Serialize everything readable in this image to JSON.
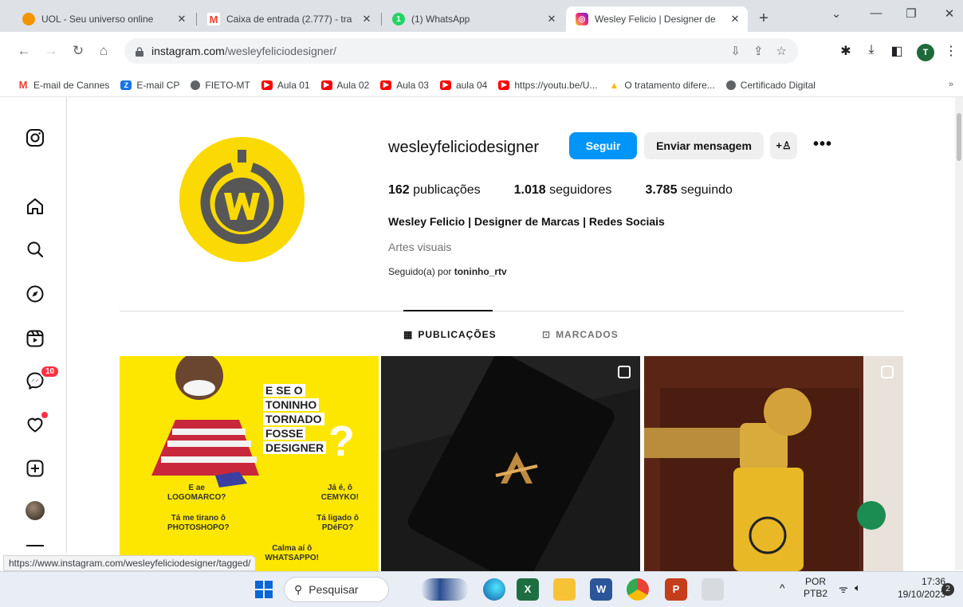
{
  "browser": {
    "tabs": [
      {
        "title": "UOL - Seu universo online",
        "icon": "uol-icon",
        "color": "#f29400"
      },
      {
        "title": "Caixa de entrada (2.777) - tra",
        "icon": "gmail-icon",
        "color": "#ea4335"
      },
      {
        "title": "(1) WhatsApp",
        "icon": "whatsapp-icon",
        "color": "#25d366"
      },
      {
        "title": "Wesley Felicio | Designer de",
        "icon": "instagram-icon",
        "color": "#d6249f"
      }
    ],
    "new_tab": "+",
    "url_domain": "instagram.com",
    "url_path": "/wesleyfeliciodesigner/",
    "profile_initial": "T",
    "bookmarks": [
      {
        "label": "E-mail de Cannes",
        "icon": "gmail-icon",
        "color": "#ea4335"
      },
      {
        "label": "E-mail CP",
        "icon": "zoho-icon",
        "color": "#1a73e8"
      },
      {
        "label": "FIETO-MT",
        "icon": "globe-icon",
        "color": "#5f6368"
      },
      {
        "label": "Aula 01",
        "icon": "youtube-icon",
        "color": "#ff0000"
      },
      {
        "label": "Aula 02",
        "icon": "youtube-icon",
        "color": "#ff0000"
      },
      {
        "label": "Aula 03",
        "icon": "youtube-icon",
        "color": "#ff0000"
      },
      {
        "label": "aula 04",
        "icon": "youtube-icon",
        "color": "#ff0000"
      },
      {
        "label": "https://youtu.be/U...",
        "icon": "youtube-icon",
        "color": "#ff0000"
      },
      {
        "label": "O tratamento difere...",
        "icon": "google-ads-icon",
        "color": "#fbbc04"
      },
      {
        "label": "Certificado Digital",
        "icon": "globe-icon",
        "color": "#5f6368"
      }
    ],
    "bookmarks_more": "»"
  },
  "instagram": {
    "nav_badge": "10",
    "username": "wesleyfeliciodesigner",
    "follow_label": "Seguir",
    "message_label": "Enviar mensagem",
    "suggest_label": "+♙",
    "more_label": "•••",
    "stats": [
      {
        "value": "162",
        "label": "publicações"
      },
      {
        "value": "1.018",
        "label": "seguidores"
      },
      {
        "value": "3.785",
        "label": "seguindo"
      }
    ],
    "full_name": "Wesley Felicio | Designer de Marcas | Redes Sociais",
    "category": "Artes visuais",
    "followed_by_prefix": "Seguido(a) por ",
    "followed_by_user": "toninho_rtv",
    "tabs": [
      {
        "label": "PUBLICAÇÕES",
        "icon": "grid-icon",
        "active": true
      },
      {
        "label": "MARCADOS",
        "icon": "tagged-icon",
        "active": false
      }
    ],
    "post1": {
      "headline": [
        "E SE O",
        "TONINHO",
        "TORNADO",
        "FOSSE",
        "DESIGNER"
      ],
      "question_mark": "?",
      "lines": [
        {
          "a": "E ae\nLOGOMARCO?",
          "b": "Já é, ô\nCEMYKO!"
        },
        {
          "a": "Tá me tirano ô\nPHOTOSHOPO?",
          "b": "Tá ligado ô\nPDéFO?"
        },
        {
          "a": "",
          "b": "Calma aí ô\nWHATSAPPO!"
        }
      ]
    },
    "accent": "#0095f6"
  },
  "status_url": "https://www.instagram.com/wesleyfeliciodesigner/tagged/",
  "taskbar": {
    "search_label": "Pesquisar",
    "lang_top": "POR",
    "lang_bottom": "PTB2",
    "time": "17:36",
    "date": "19/10/2023",
    "notifications": "2"
  }
}
